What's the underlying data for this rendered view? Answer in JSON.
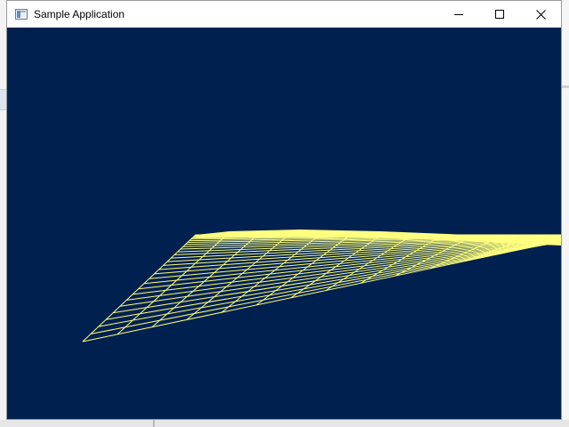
{
  "window": {
    "title": "Sample Application"
  },
  "title_controls": {
    "minimize_icon": "minimize-icon",
    "maximize_icon": "maximize-icon",
    "close_icon": "close-icon"
  },
  "viewport": {
    "background_color": "#00214f",
    "grid_color": "#ffff80",
    "content": "3d-wireframe-grid"
  }
}
